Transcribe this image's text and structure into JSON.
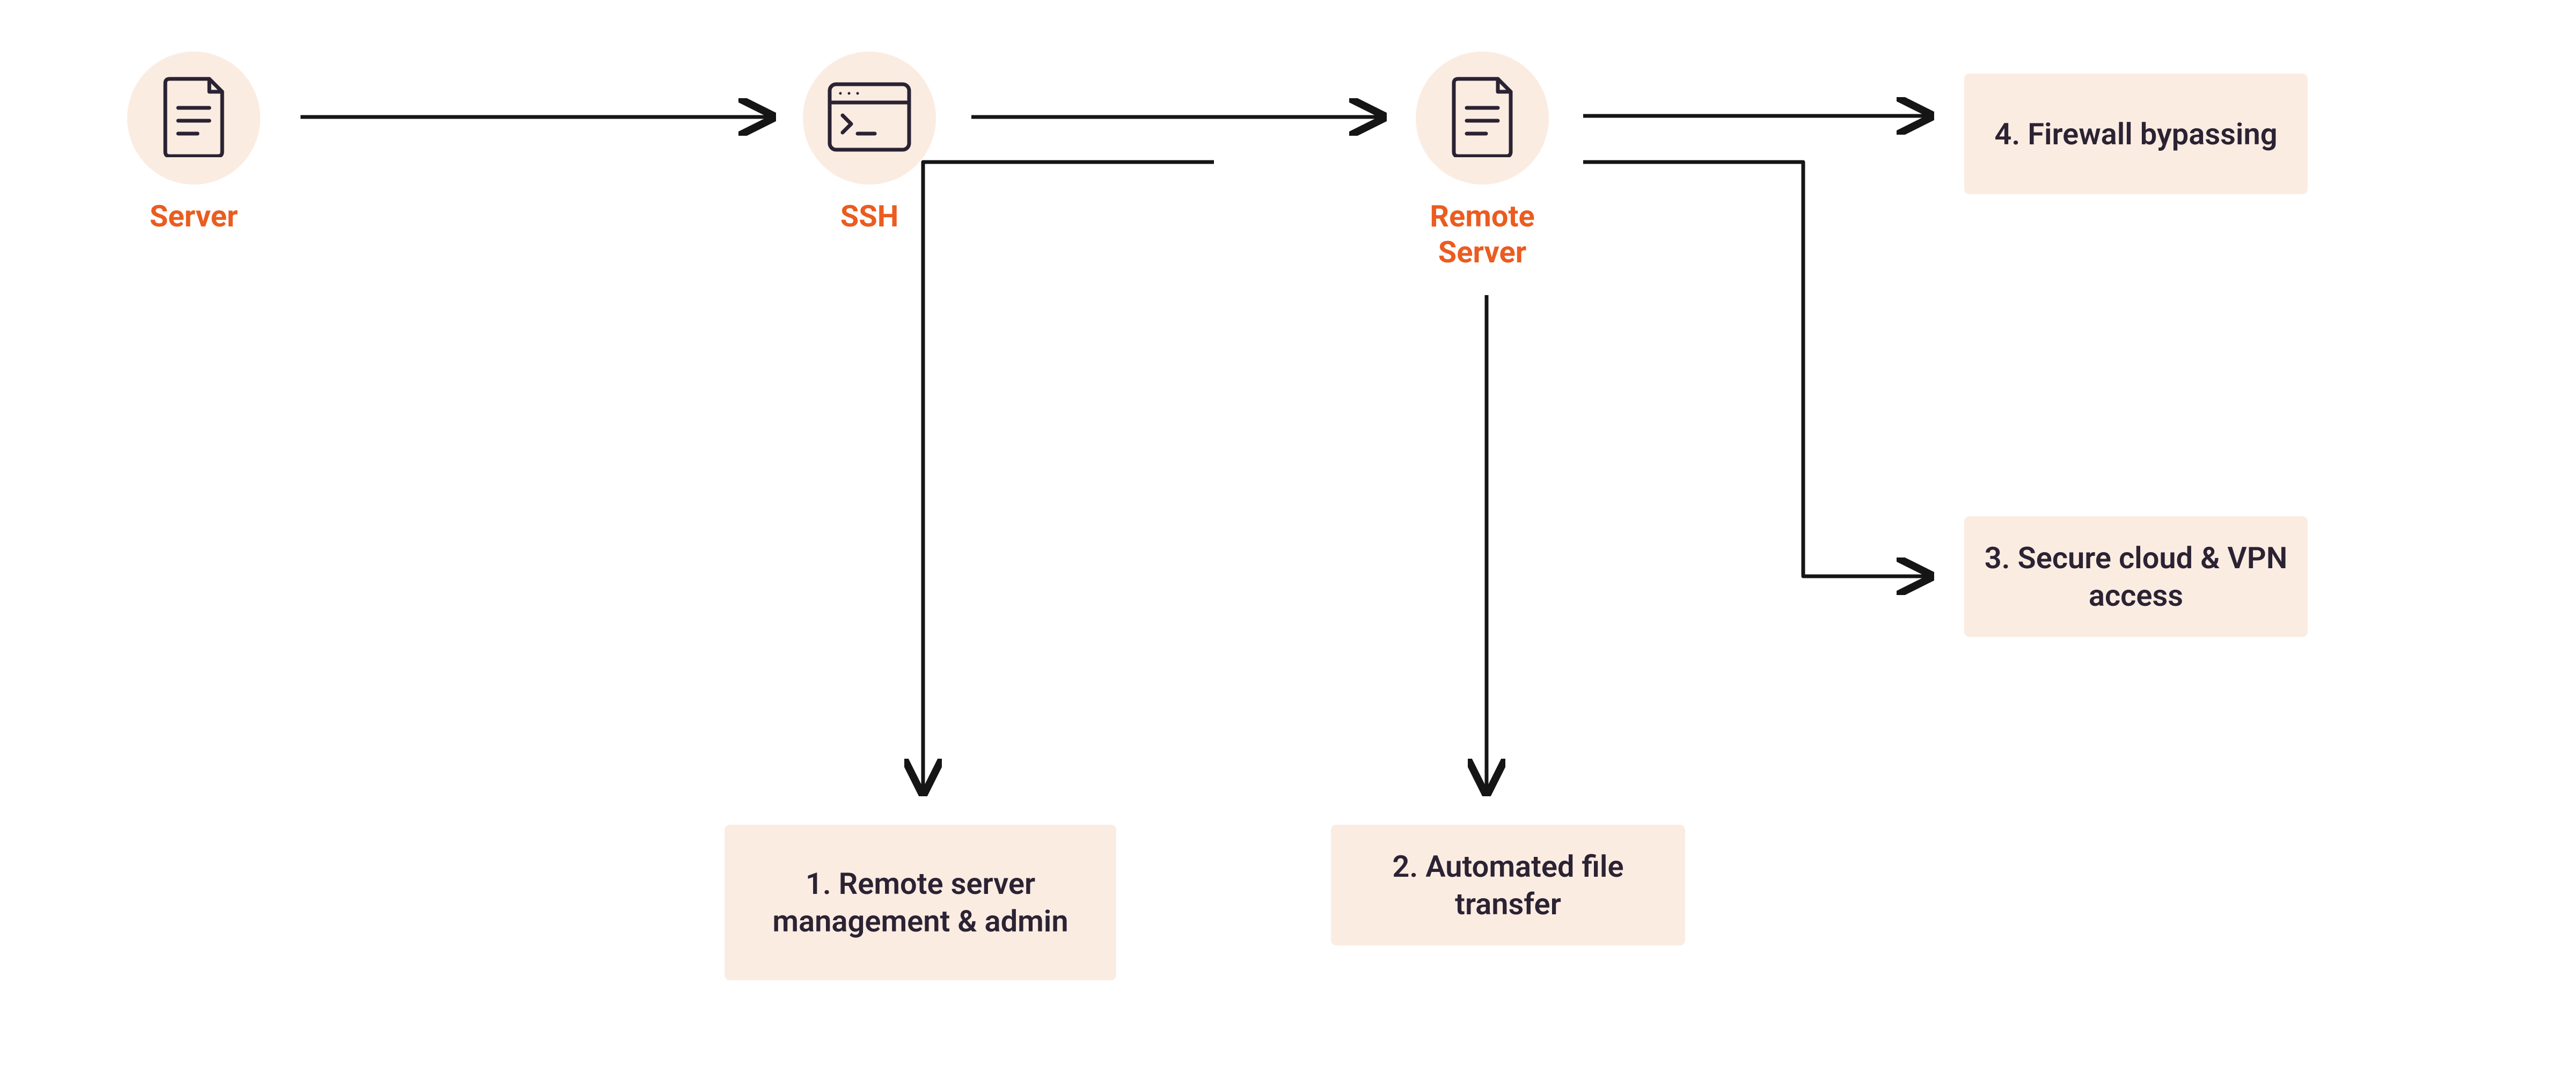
{
  "nodes": {
    "server": {
      "label": "Server"
    },
    "ssh": {
      "label": "SSH"
    },
    "remote": {
      "label": "Remote\nServer"
    }
  },
  "uses": {
    "u1": "1.  Remote server management & admin",
    "u2": "2.  Automated file transfer",
    "u3": "3.  Secure cloud & VPN access",
    "u4": "4.  Firewall bypassing"
  },
  "colors": {
    "accent": "#EB5C20",
    "pale": "#FBECE2",
    "text": "#2B2333",
    "line": "#151515"
  }
}
